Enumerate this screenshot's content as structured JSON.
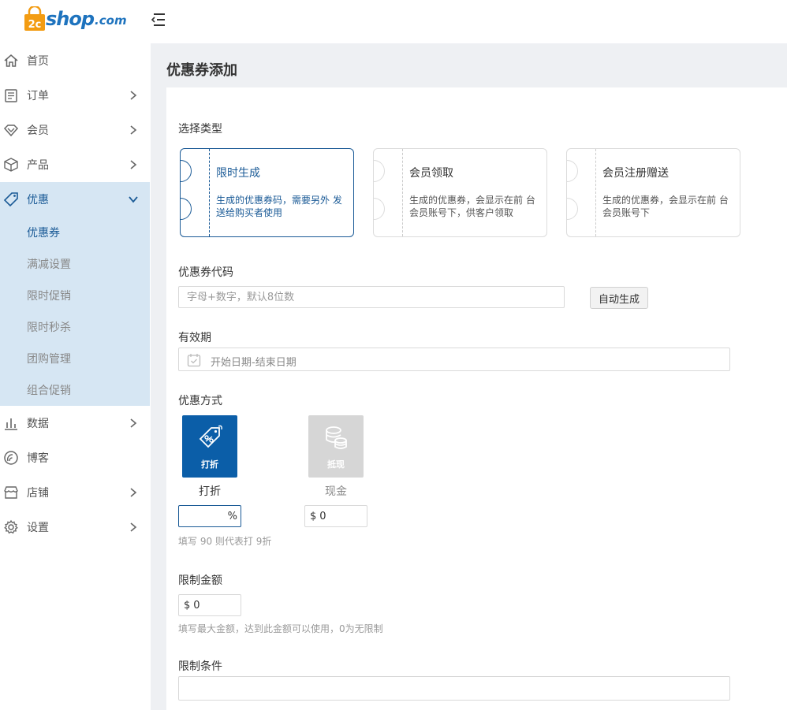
{
  "header": {
    "logo_prefix": "2c",
    "logo_text": "shop",
    "logo_suffix": ".com"
  },
  "sidebar": {
    "items": [
      {
        "label": "首页",
        "icon": "home-icon"
      },
      {
        "label": "订单",
        "icon": "order-icon"
      },
      {
        "label": "会员",
        "icon": "member-icon"
      },
      {
        "label": "产品",
        "icon": "product-icon"
      },
      {
        "label": "优惠",
        "icon": "promo-tag-icon"
      },
      {
        "label": "数据",
        "icon": "chart-icon"
      },
      {
        "label": "博客",
        "icon": "blog-icon"
      },
      {
        "label": "店铺",
        "icon": "store-icon"
      },
      {
        "label": "设置",
        "icon": "gear-icon"
      }
    ],
    "promo_sub": [
      "优惠券",
      "满减设置",
      "限时促销",
      "限时秒杀",
      "团购管理",
      "组合促销"
    ]
  },
  "page": {
    "title": "优惠券添加"
  },
  "form": {
    "type_label": "选择类型",
    "types": [
      {
        "title": "限时生成",
        "desc": "生成的优惠券码，需要另外 发送给购买者使用"
      },
      {
        "title": "会员领取",
        "desc": "生成的优惠券，会显示在前 台会员账号下，供客户领取"
      },
      {
        "title": "会员注册赠送",
        "desc": "生成的优惠券，会显示在前 台会员账号下"
      }
    ],
    "code_label": "优惠券代码",
    "code_placeholder": "字母+数字，默认8位数",
    "auto_gen": "自动生成",
    "validity_label": "有效期",
    "validity_placeholder": "开始日期-结束日期",
    "discount_label": "优惠方式",
    "discount_modes": [
      {
        "tile": "打折",
        "caption": "打折"
      },
      {
        "tile": "抵现",
        "caption": "现金"
      }
    ],
    "percent_suffix": "%",
    "currency": "$",
    "cash_value": "0",
    "discount_hint": "填写 90 则代表打 9折",
    "limit_amount_label": "限制金额",
    "limit_amount_value": "0",
    "limit_amount_hint": "填写最大金额，达到此金额可以使用，0为无限制",
    "limit_condition_label": "限制条件"
  },
  "colors": {
    "primary": "#0b5ea8",
    "active_bg": "#d6e6f3",
    "logo_orange": "#f39c12"
  }
}
